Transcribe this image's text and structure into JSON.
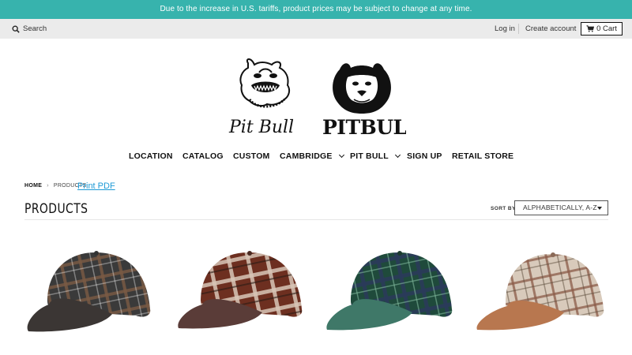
{
  "announcement": "Due to the increase in U.S. tariffs, product prices may be subject to change at any time.",
  "utility": {
    "search_label": "Search",
    "login_label": "Log in",
    "create_account_label": "Create account",
    "cart_label": "0 Cart"
  },
  "logo": {
    "script_text": "Pit Bull",
    "block_text": "PITBULL"
  },
  "nav": {
    "items": [
      {
        "label": "LOCATION",
        "dropdown": false
      },
      {
        "label": "CATALOG",
        "dropdown": false
      },
      {
        "label": "CUSTOM",
        "dropdown": false
      },
      {
        "label": "CAMBRIDGE",
        "dropdown": true
      },
      {
        "label": "PIT BULL",
        "dropdown": true
      },
      {
        "label": "SIGN UP",
        "dropdown": false
      },
      {
        "label": "RETAIL STORE",
        "dropdown": false
      }
    ]
  },
  "breadcrumb": {
    "home": "HOME",
    "current": "PRODUCTS"
  },
  "print_pdf_label": "Print PDF",
  "page_title": "PRODUCTS",
  "sort": {
    "label": "SORT BY",
    "selected": "ALPHABETICALLY, A-Z"
  },
  "products": [
    {
      "description": "black plaid cap",
      "plaid": "#3a3a3a",
      "accent": "#7a5a44",
      "brim": "#3b3634"
    },
    {
      "description": "red plaid cap",
      "plaid": "#6d2f20",
      "accent": "#d8c6b6",
      "brim": "#5a3c38"
    },
    {
      "description": "green plaid cap",
      "plaid": "#1f4a3b",
      "accent": "#2a3a5a",
      "brim": "#3f7868"
    },
    {
      "description": "beige plaid cap",
      "plaid": "#d8cabb",
      "accent": "#8a5a48",
      "brim": "#b8774f"
    }
  ]
}
